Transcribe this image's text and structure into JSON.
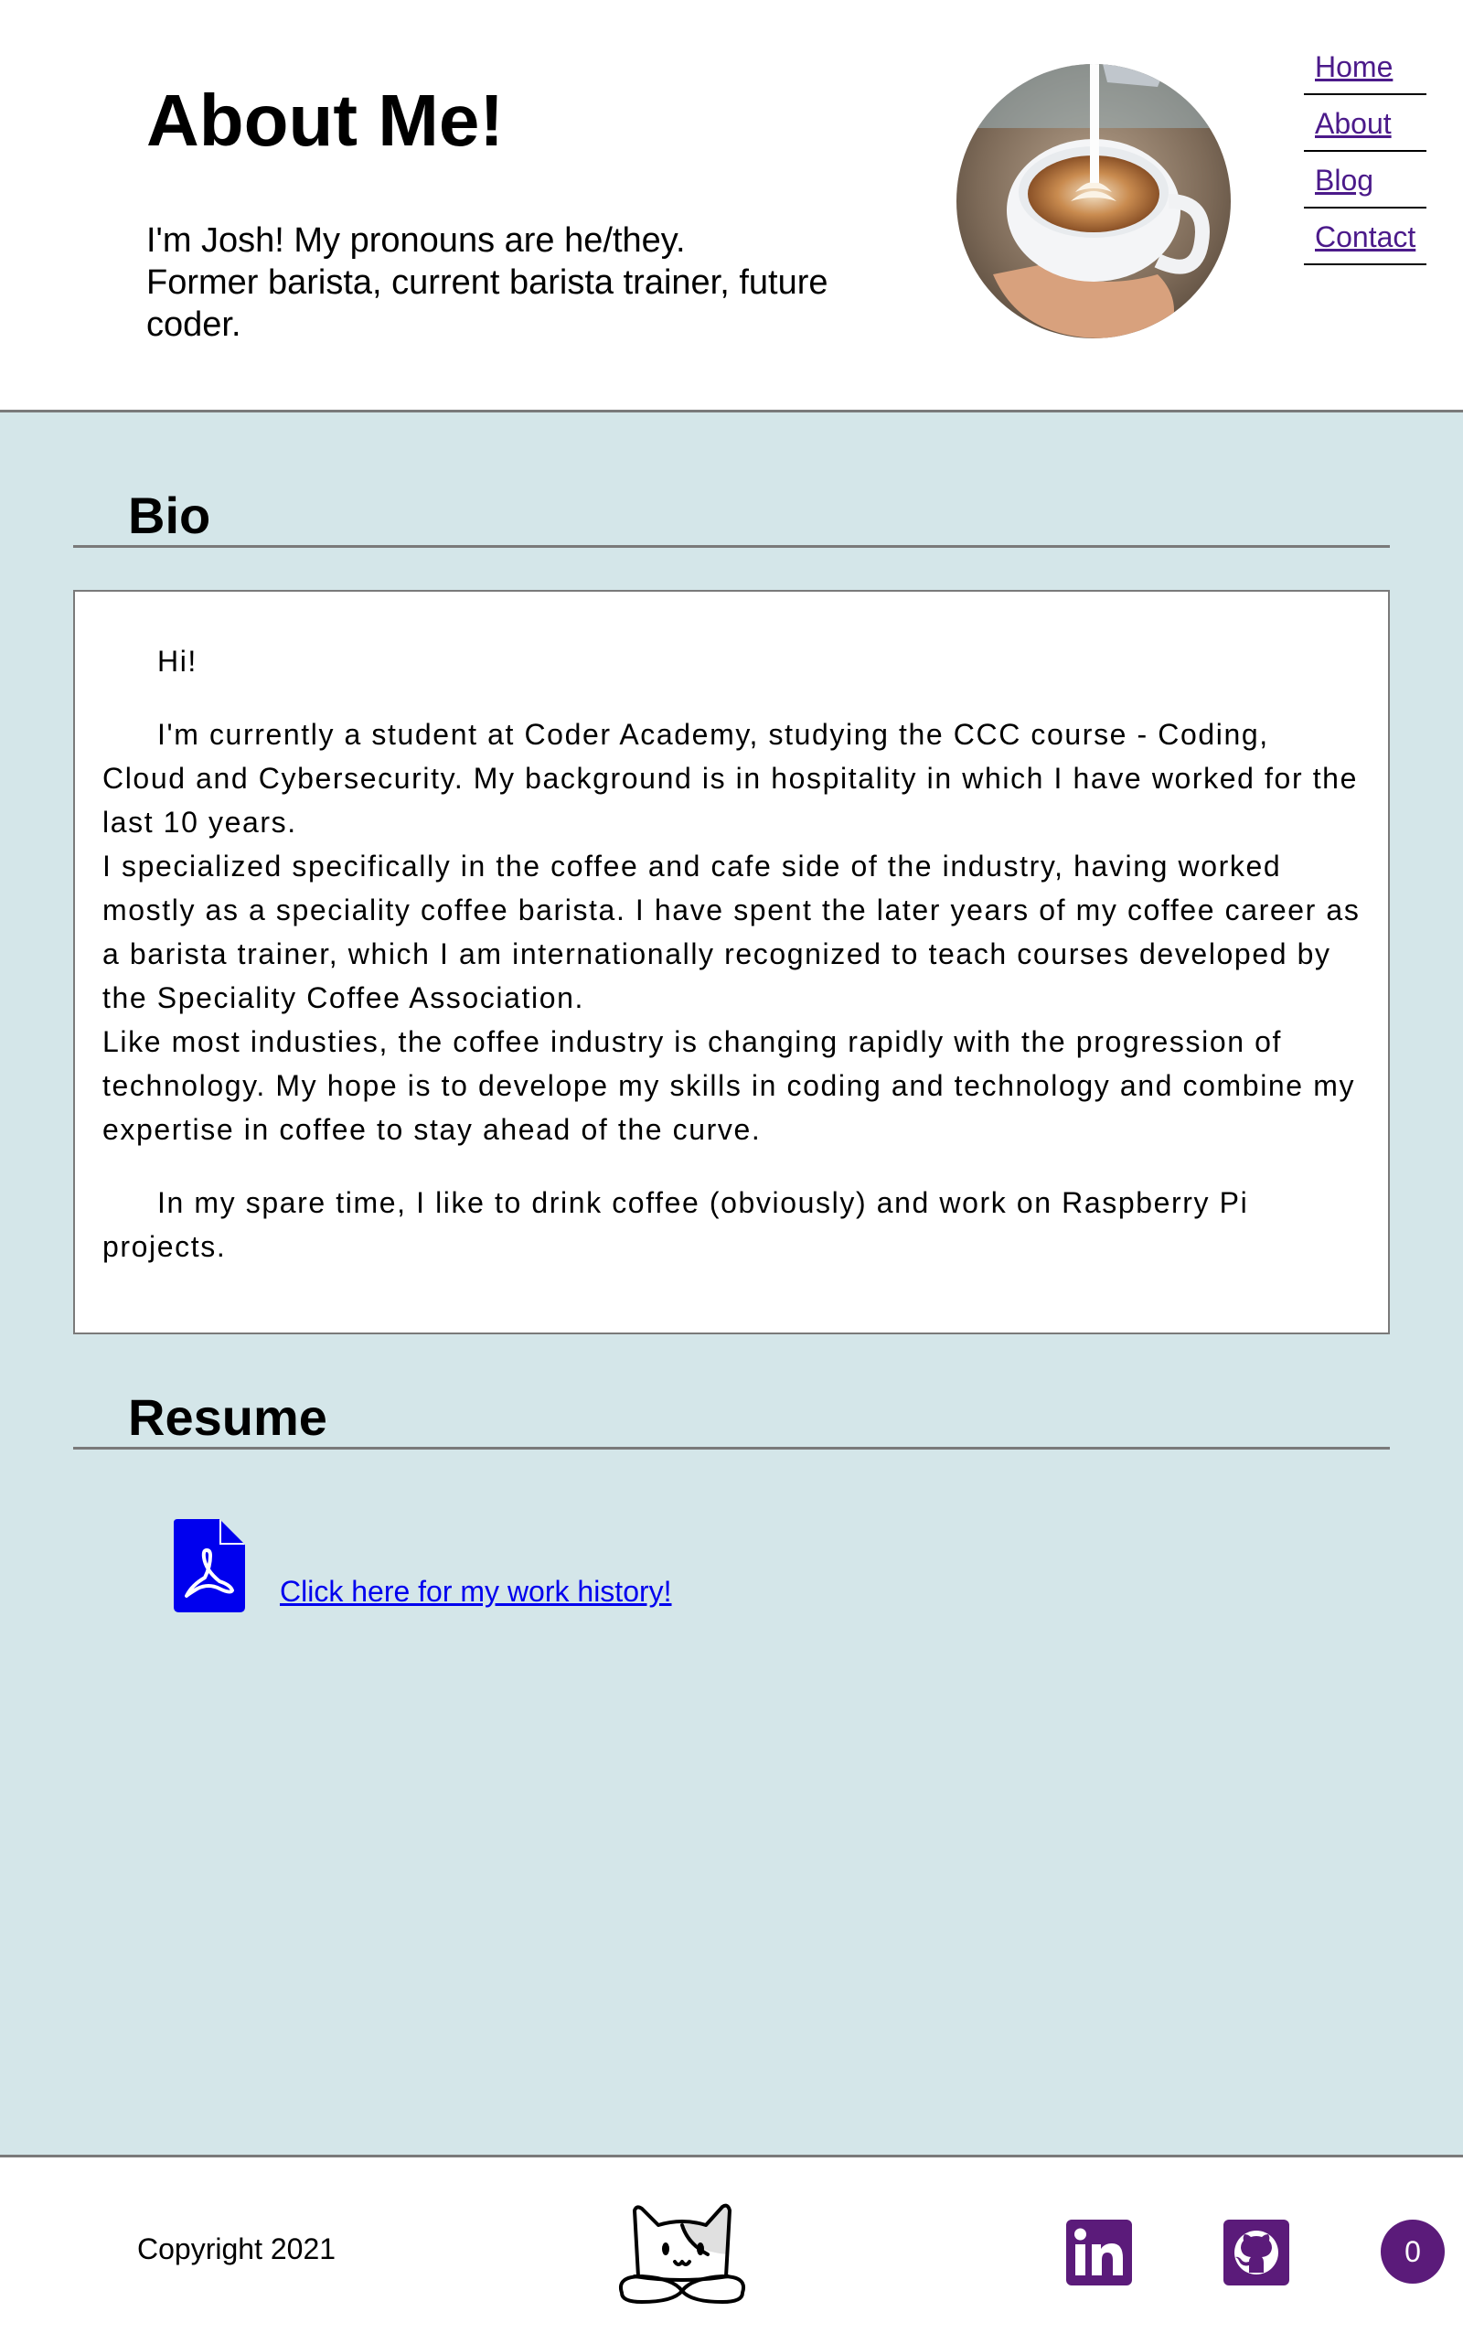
{
  "header": {
    "title": "About Me!",
    "intro_line1": "I'm Josh! My pronouns are he/they.",
    "intro_line2": "Former barista, current barista trainer, future coder.",
    "avatar_icon": "latte-art-coffee-photo"
  },
  "nav": {
    "items": [
      {
        "label": "Home"
      },
      {
        "label": "About"
      },
      {
        "label": "Blog"
      },
      {
        "label": "Contact"
      }
    ]
  },
  "bio": {
    "heading": "Bio",
    "greeting": "Hi!",
    "para1": "I'm currently a student at Coder Academy, studying the CCC course - Coding, Cloud and Cybersecurity. My background is in hospitality in which I have worked for the last 10 years.",
    "para2": "I specialized specifically in the coffee and cafe side of the industry, having worked mostly as a speciality coffee barista. I have spent the later years of my coffee career as a barista trainer, which I am internationally recognized to teach courses developed by the Speciality Coffee Association.",
    "para3": "Like most industies, the coffee industry is changing rapidly with the progression of technology. My hope is to develope my skills in coding and technology and combine my expertise in coffee to stay ahead of the curve.",
    "para4": "In my spare time, I like to drink coffee (obviously) and work on Raspberry Pi projects."
  },
  "resume": {
    "heading": "Resume",
    "link_label": "Click here for my work history!",
    "icon": "pdf-file-icon"
  },
  "footer": {
    "copyright": "Copyright 2021",
    "logo_icon": "cat-logo",
    "linkedin_icon": "linkedin-icon",
    "github_icon": "github-icon",
    "badge_count": "0"
  },
  "colors": {
    "main_background": "#d4e6e9",
    "nav_link": "#4b1a8a",
    "resume_link": "#0000ee",
    "pdf_icon": "#0000ee",
    "social_icon": "#5b1b7a",
    "badge": "#5b1b7a",
    "divider": "#7a7a7a"
  }
}
